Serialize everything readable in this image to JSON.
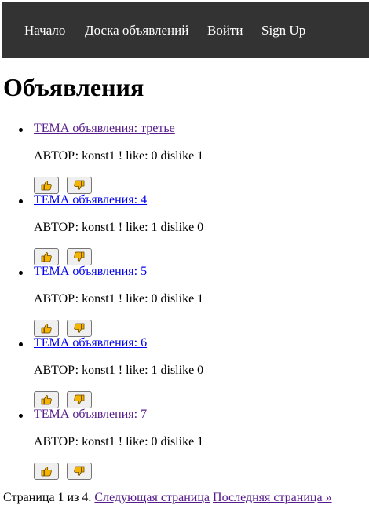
{
  "nav": {
    "items": [
      {
        "label": "Начало"
      },
      {
        "label": "Доска объявлений"
      },
      {
        "label": "Войти"
      },
      {
        "label": "Sign Up"
      }
    ]
  },
  "page": {
    "title": "Объявления"
  },
  "ads": [
    {
      "title": "ТЕМА объявления: третье",
      "meta": "АВТОР: konst1 ! like: 0 dislike 1",
      "visited": true
    },
    {
      "title": "ТЕМА объявления: 4",
      "meta": "АВТОР: konst1 ! like: 1 dislike 0",
      "visited": false
    },
    {
      "title": "ТЕМА объявления: 5",
      "meta": "АВТОР: konst1 ! like: 0 dislike 1",
      "visited": false
    },
    {
      "title": "ТЕМА объявления: 6",
      "meta": "АВТОР: konst1 ! like: 1 dislike 0",
      "visited": false
    },
    {
      "title": "ТЕМА объявления: 7",
      "meta": "АВТОР: konst1 ! like: 0 dislike 1",
      "visited": true
    }
  ],
  "vote_icons": {
    "like": "thumbs-up-icon",
    "dislike": "thumbs-down-icon",
    "color": "#f5b400"
  },
  "pagination": {
    "status": "Страница 1 из 4.",
    "next_label": "Следующая страница",
    "last_label": "Последняя страница »"
  }
}
